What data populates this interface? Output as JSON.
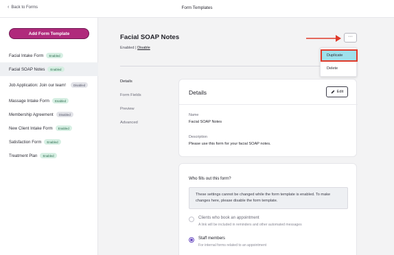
{
  "header": {
    "back_label": "Back to Forms",
    "title": "Form Templates"
  },
  "sidebar": {
    "add_button": "Add Form Template",
    "items": [
      {
        "label": "Facial Intake Form",
        "status": "Enabled"
      },
      {
        "label": "Facial SOAP Notes",
        "status": "Enabled"
      },
      {
        "label": "Job Application: Join our team!",
        "status": "Disabled"
      },
      {
        "label": "Massage Intake Form",
        "status": "Enabled"
      },
      {
        "label": "Membership Agreement",
        "status": "Disabled"
      },
      {
        "label": "New Client Intake Form",
        "status": "Enabled"
      },
      {
        "label": "Satisfaction Form",
        "status": "Enabled"
      },
      {
        "label": "Treatment Plan",
        "status": "Enabled"
      }
    ]
  },
  "form": {
    "title": "Facial SOAP Notes",
    "status": "Enabled",
    "separator": "|",
    "disable_link": "Disable",
    "more_label": "···"
  },
  "menu": {
    "duplicate": "Duplicate",
    "delete": "Delete"
  },
  "subnav": {
    "items": [
      "Details",
      "Form Fields",
      "Preview",
      "Advanced"
    ]
  },
  "details": {
    "title": "Details",
    "edit_label": "Edit",
    "name_label": "Name",
    "name_value": "Facial SOAP Notes",
    "description_label": "Description",
    "description_value": "Please use this form for your facial SOAP notes."
  },
  "fill": {
    "question": "Who fills out this form?",
    "notice": "These settings cannot be changed while the form template is enabled. To make changes here, please disable the form template.",
    "options": [
      {
        "label": "Clients who book an appointment",
        "sub": "A link will be included in reminders and other automated messages",
        "checked": false
      },
      {
        "label": "Staff members",
        "sub": "For internal forms related to an appointment",
        "checked": true
      }
    ]
  },
  "colors": {
    "brand": "#b02a7c",
    "highlight": "#9ee1ec",
    "annotation_red": "#e03a2a",
    "radio_accent": "#6d4fc2"
  }
}
